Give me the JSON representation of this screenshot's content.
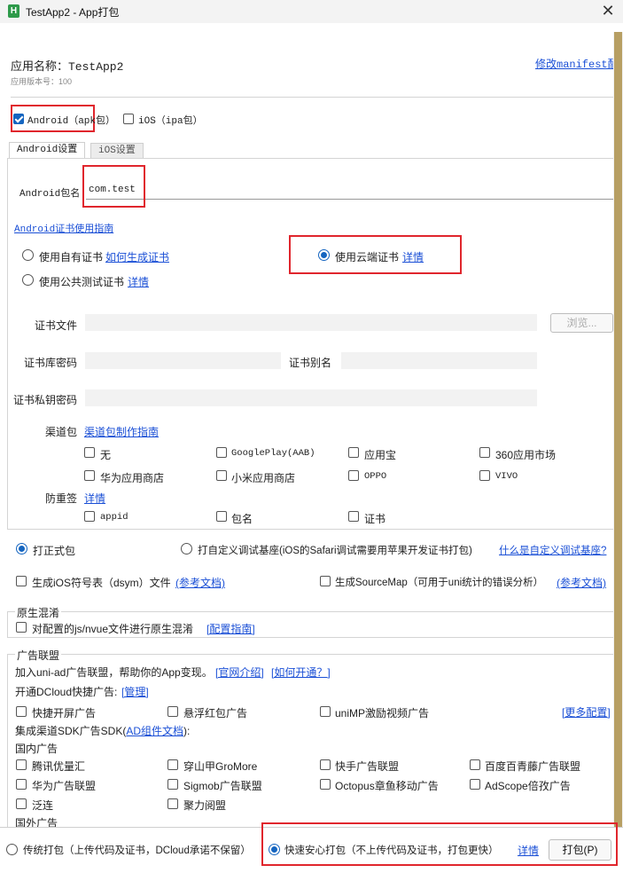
{
  "window": {
    "icon_letter": "H",
    "title": "TestApp2 - App打包",
    "close_glyph": "✕"
  },
  "header": {
    "app_name": "应用名称：TestApp2",
    "app_version": "应用版本号：100",
    "manifest_link": "修改manifest配置"
  },
  "platforms": {
    "android": "Android（apk包）",
    "ios": "iOS（ipa包）"
  },
  "tabs": {
    "android": "Android设置",
    "ios": "iOS设置"
  },
  "android": {
    "package_label": "Android包名",
    "package_value": "com.test",
    "cert_guide": "Android证书使用指南",
    "own_cert": "使用自有证书",
    "how_generate": "如何生成证书",
    "cloud_cert": "使用云端证书",
    "cloud_detail": "详情",
    "public_test_cert": "使用公共测试证书",
    "public_detail": "详情",
    "cert_file": "证书文件",
    "browse": "浏览...",
    "keystore_pwd": "证书库密码",
    "alias": "证书别名",
    "private_pwd": "证书私钥密码",
    "channel_label": "渠道包",
    "channel_guide": "渠道包制作指南",
    "channels": {
      "none": "无",
      "googleplay": "GooglePlay(AAB)",
      "yyb": "应用宝",
      "q360": "360应用市场",
      "huawei": "华为应用商店",
      "xiaomi": "小米应用商店",
      "oppo": "OPPO",
      "vivo": "VIVO"
    },
    "anti_resign_label": "防重签",
    "anti_resign_detail": "详情",
    "anti_resign": {
      "appid": "appid",
      "pkg": "包名",
      "cert": "证书"
    }
  },
  "build": {
    "formal": "打正式包",
    "custom_base": "打自定义调试基座(iOS的Safari调试需要用苹果开发证书打包)",
    "what_custom": "什么是自定义调试基座?",
    "dsym": "生成iOS符号表（dsym）文件",
    "dsym_ref": "(参考文档)",
    "sourcemap": "生成SourceMap（可用于uni统计的错误分析）",
    "sourcemap_ref": "(参考文档)"
  },
  "obfuscation": {
    "legend": "原生混淆",
    "option": "对配置的js/nvue文件进行原生混淆",
    "guide": "[配置指南]"
  },
  "ads": {
    "legend": "广告联盟",
    "intro": "加入uni-ad广告联盟，帮助你的App变现。",
    "official": "[官网介绍]",
    "how_open": "[如何开通？]",
    "dcloud_label": "开通DCloud快捷广告:",
    "manage": "[管理]",
    "splash": "快捷开屏广告",
    "float_red": "悬浮红包广告",
    "reward": "uniMP激励视频广告",
    "more": "[更多配置]",
    "sdk_label": "集成渠道SDK广告SDK(",
    "sdk_doc": "AD组件文档",
    "sdk_label_end": "):",
    "domestic": "国内广告",
    "tencent": "腾讯优量汇",
    "csj": "穿山甲GroMore",
    "kuaishou": "快手广告联盟",
    "baidu": "百度百青藤广告联盟",
    "huawei_ad": "华为广告联盟",
    "sigmob": "Sigmob广告联盟",
    "octopus": "Octopus章鱼移动广告",
    "adscope": "AdScope倍孜广告",
    "fanlian": "泛连",
    "juli": "聚力阅盟",
    "foreign": "国外广告"
  },
  "footer": {
    "traditional": "传统打包（上传代码及证书，DCloud承诺不保留）",
    "fast_safe": "快速安心打包（不上传代码及证书，打包更快）",
    "fast_detail": "详情",
    "pack_button": "打包(P)"
  }
}
